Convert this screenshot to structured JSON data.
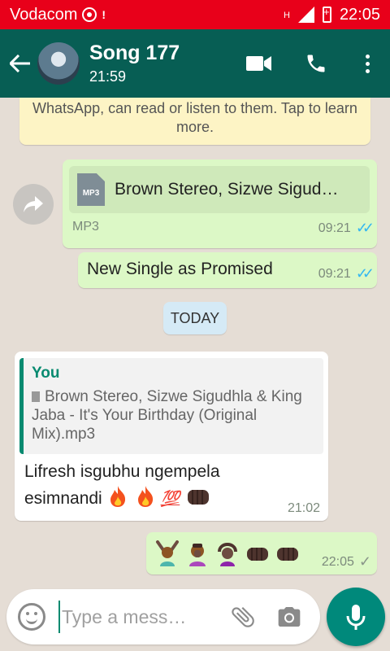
{
  "status": {
    "carrier": "Vodacom",
    "network": "H",
    "time": "22:05"
  },
  "header": {
    "contact_name": "Song 177",
    "last_seen": "21:59"
  },
  "notice": {
    "text": "WhatsApp, can read or listen to them. Tap to learn more."
  },
  "messages": {
    "file_msg": {
      "file_type_icon": "MP3",
      "file_name": "Brown Stereo, Sizwe Sigud…",
      "file_type": "MP3",
      "time": "09:21",
      "ticks": "✓✓"
    },
    "text_msg": {
      "text": "New Single as Promised",
      "time": "09:21",
      "ticks": "✓✓"
    },
    "date_chip": "TODAY",
    "reply_msg": {
      "quote_author": "You",
      "quote_text": "Brown Stereo, Sizwe Sigudhla & King Jaba - It's Your Birthday (Original Mix).mp3",
      "text": "Lifresh isgubhu ngempela esimnandi",
      "emoji_100": "💯",
      "time": "21:02"
    },
    "emoji_msg": {
      "time": "22:05",
      "ticks": "✓"
    }
  },
  "composer": {
    "placeholder": "Type a mess…"
  },
  "colors": {
    "status_bar": "#e8001a",
    "app_bar": "#075e54",
    "outgoing_bubble": "#dcf8c6",
    "read_ticks": "#34b7f1",
    "mic_button": "#00897b"
  }
}
